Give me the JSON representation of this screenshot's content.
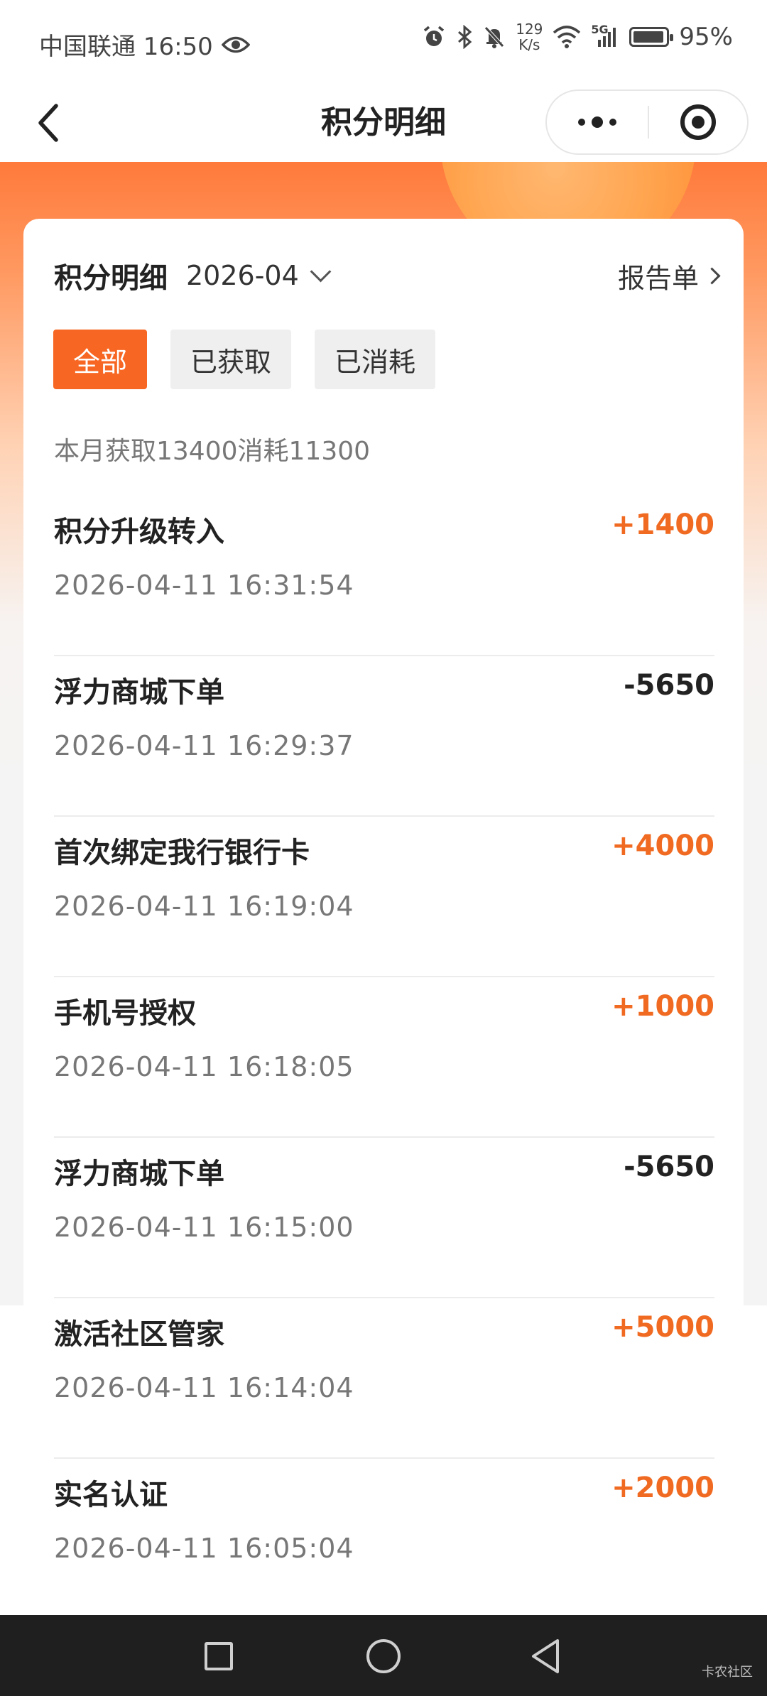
{
  "status_bar": {
    "carrier_time": "中国联通 16:50",
    "speed_value": "129",
    "speed_unit": "K/s",
    "network": "5G",
    "battery": "95%",
    "battery_level": 0.95
  },
  "header": {
    "title": "积分明细"
  },
  "card": {
    "title": "积分明细",
    "month": "2026-04",
    "report_label": "报告单",
    "tabs": [
      {
        "label": "全部",
        "active": true
      },
      {
        "label": "已获取",
        "active": false
      },
      {
        "label": "已消耗",
        "active": false
      }
    ],
    "summary": "本月获取13400消耗11300",
    "records": [
      {
        "name": "积分升级转入",
        "amount": "+1400",
        "time": "2026-04-11 16:31:54"
      },
      {
        "name": "浮力商城下单",
        "amount": "-5650",
        "time": "2026-04-11 16:29:37"
      },
      {
        "name": "首次绑定我行银行卡",
        "amount": "+4000",
        "time": "2026-04-11 16:19:04"
      },
      {
        "name": "手机号授权",
        "amount": "+1000",
        "time": "2026-04-11 16:18:05"
      },
      {
        "name": "浮力商城下单",
        "amount": "-5650",
        "time": "2026-04-11 16:15:00"
      },
      {
        "name": "激活社区管家",
        "amount": "+5000",
        "time": "2026-04-11 16:14:04"
      },
      {
        "name": "实名认证",
        "amount": "+2000",
        "time": "2026-04-11 16:05:04"
      }
    ]
  },
  "colors": {
    "accent": "#f76622",
    "positive": "#f06a22",
    "negative": "#222222"
  },
  "watermark": "卡农社区"
}
